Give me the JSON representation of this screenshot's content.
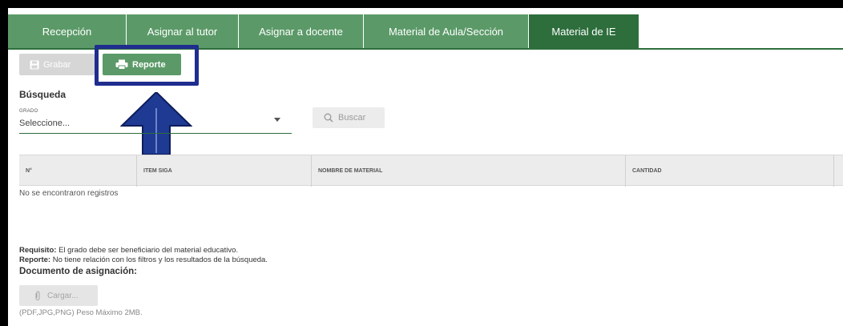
{
  "tabs": [
    {
      "label": "Recepción",
      "active": false
    },
    {
      "label": "Asignar al tutor",
      "active": false
    },
    {
      "label": "Asignar a docente",
      "active": false
    },
    {
      "label": "Material de Aula/Sección",
      "active": false
    },
    {
      "label": "Material de IE",
      "active": true
    }
  ],
  "toolbar": {
    "grabar_label": "Grabar",
    "reporte_label": "Reporte"
  },
  "search": {
    "title": "Búsqueda",
    "grado_label": "GRADO",
    "grado_value": "Seleccione...",
    "buscar_label": "Buscar"
  },
  "table": {
    "columns": [
      "N°",
      "ITEM SIGA",
      "NOMBRE DE MATERIAL",
      "CANTIDAD"
    ],
    "empty_message": "No se encontraron registros"
  },
  "notes": {
    "requisito_label": "Requisito:",
    "requisito_text": "El grado debe ser beneficiario del material educativo.",
    "reporte_label": "Reporte:",
    "reporte_text": "No tiene relación con los filtros y los resultados de la búsqueda."
  },
  "document": {
    "title": "Documento de asignación:",
    "cargar_label": "Cargar...",
    "formats_text": "(PDF,JPG,PNG) Peso Máximo 2MB."
  },
  "colors": {
    "tab_green": "#5b9a68",
    "tab_active": "#2d6e3c",
    "highlight_blue": "#1f2d8f",
    "arrow_blue": "#1f3a93"
  }
}
